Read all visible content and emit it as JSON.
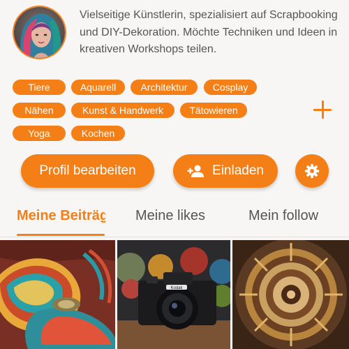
{
  "profile": {
    "bio": "Vielseitige Künstlerin, spezialisiert auf Scrapbooking und DIY-Dekoration. Möchte Techniken und Ideen in kreativen Workshops teilen."
  },
  "tags": [
    "Tiere",
    "Aquarell",
    "Architektur",
    "Cosplay",
    "Nähen",
    "Kunst & Handwerk",
    "Tätowieren",
    "Yoga",
    "Kochen"
  ],
  "actions": {
    "edit_label": "Profil bearbeiten",
    "invite_label": "Einladen",
    "invite_icon": "person-add-icon",
    "settings_icon": "gear-icon",
    "add_tag_icon": "plus-icon"
  },
  "tabs": [
    {
      "label": "Meine Beiträge",
      "active": true
    },
    {
      "label": "Meine likes",
      "active": false
    },
    {
      "label": "Mein follow",
      "active": false
    }
  ],
  "posts": [
    {
      "image": "embroidery-artwork"
    },
    {
      "image": "kodak-camera"
    },
    {
      "image": "bronze-mandala"
    }
  ],
  "colors": {
    "accent": "#f47f16",
    "background": "#f8f6f4",
    "text": "#555555"
  }
}
